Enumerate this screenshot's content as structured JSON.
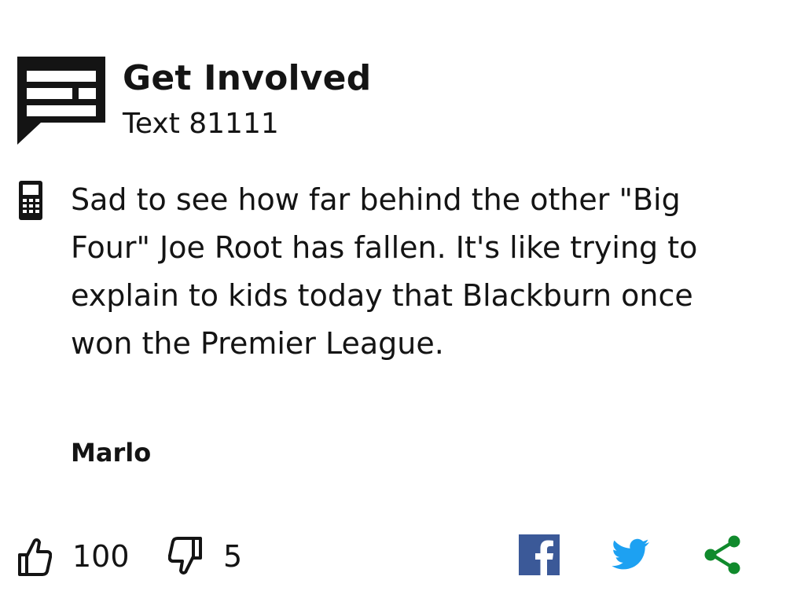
{
  "header": {
    "title": "Get Involved",
    "subtitle": "Text 81111",
    "logo_icon": "speech-bubble-icon"
  },
  "message": {
    "source_icon": "mobile-phone-icon",
    "text": "Sad to see how far behind the other \"Big Four\" Joe Root has fallen. It's like trying to explain to kids today that Blackburn once won the Premier League.",
    "author": "Marlo"
  },
  "actions": {
    "like_icon": "thumbs-up-icon",
    "like_count": "100",
    "dislike_icon": "thumbs-down-icon",
    "dislike_count": "5",
    "share": [
      {
        "name": "facebook-icon",
        "color": "#3b5998"
      },
      {
        "name": "twitter-icon",
        "color": "#1da1f2"
      },
      {
        "name": "share-icon",
        "color": "#108a2c"
      }
    ]
  }
}
